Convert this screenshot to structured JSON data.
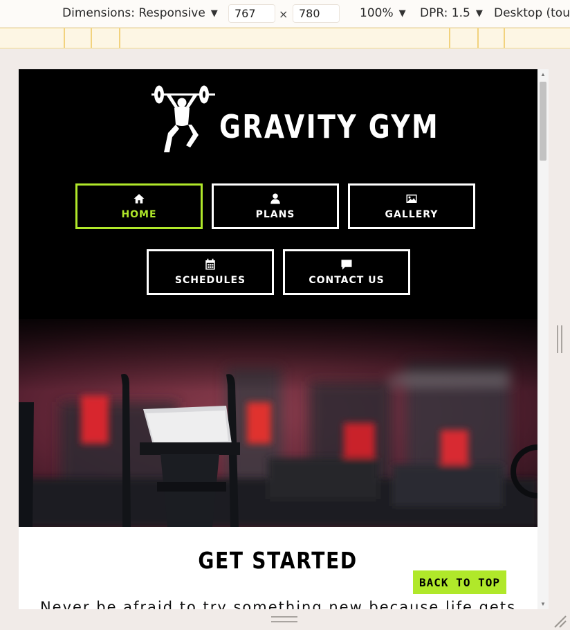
{
  "devtools": {
    "dimensions_label": "Dimensions: Responsive",
    "width_value": "767",
    "times_symbol": "×",
    "height_value": "780",
    "zoom": "100%",
    "dpr": "DPR: 1.5",
    "device_mode": "Desktop (touc",
    "caret": "▼"
  },
  "site": {
    "title": "GRAVITY GYM",
    "nav": [
      {
        "label": "HOME",
        "icon": "home-icon",
        "active": true
      },
      {
        "label": "PLANS",
        "icon": "user-icon",
        "active": false
      },
      {
        "label": "GALLERY",
        "icon": "image-icon",
        "active": false
      },
      {
        "label": "SCHEDULES",
        "icon": "calendar-icon",
        "active": false
      },
      {
        "label": "CONTACT US",
        "icon": "chat-icon",
        "active": false
      }
    ],
    "section_title": "GET STARTED",
    "intro_text": "Never be afraid to try something new because life gets",
    "back_to_top": "BACK TO TOP",
    "colors": {
      "accent": "#b0e82a",
      "header_bg": "#000000"
    }
  }
}
